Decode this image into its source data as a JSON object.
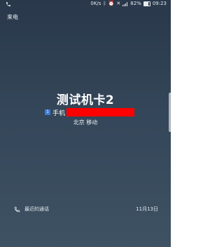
{
  "status_bar": {
    "call_icon": "phone-icon",
    "speed": "0K/s",
    "battery": "82%",
    "time": "09:23"
  },
  "incoming_label": "来电",
  "caller": {
    "name": "测试机卡2",
    "sim_badge": "1",
    "number_type": "手机",
    "location": "北京 移动"
  },
  "recent_calls": {
    "label": "最近的通话",
    "date": "11月13日"
  },
  "colors": {
    "redaction": "#ff0000",
    "sim_badge": "#3c7bd6"
  }
}
